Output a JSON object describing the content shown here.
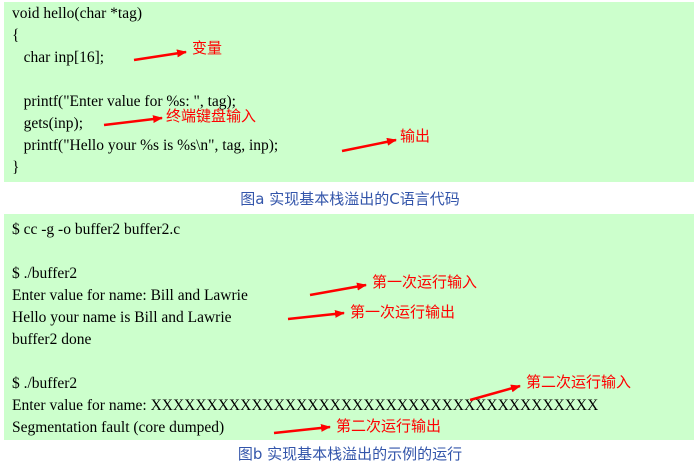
{
  "figure_a": {
    "code_lines": [
      "void hello(char *tag)",
      "{",
      "   char inp[16];",
      "",
      "   printf(\"Enter value for %s: \", tag);",
      "   gets(inp);",
      "   printf(\"Hello your %s is %s\\n\", tag, inp);",
      "}"
    ],
    "annotations": [
      "变量",
      "终端键盘输入",
      "输出"
    ],
    "caption": "图a 实现基本栈溢出的C语言代码"
  },
  "figure_b": {
    "output_lines": [
      "$ cc -g -o buffer2 buffer2.c",
      "",
      "$ ./buffer2",
      "Enter value for name: Bill and Lawrie",
      "Hello your name is Bill and Lawrie",
      "buffer2 done",
      "",
      "$ ./buffer2",
      "Enter value for name: XXXXXXXXXXXXXXXXXXXXXXXXXXXXXXXXXXXXXXXX",
      "Segmentation fault (core dumped)"
    ],
    "annotations": [
      "第一次运行输入",
      "第一次运行输出",
      "第二次运行输入",
      "第二次运行输出"
    ],
    "caption": "图b 实现基本栈溢出的示例的运行"
  },
  "colors": {
    "panel_background": "#ccffcc",
    "annotation": "#ff0000",
    "caption": "#3355aa"
  }
}
